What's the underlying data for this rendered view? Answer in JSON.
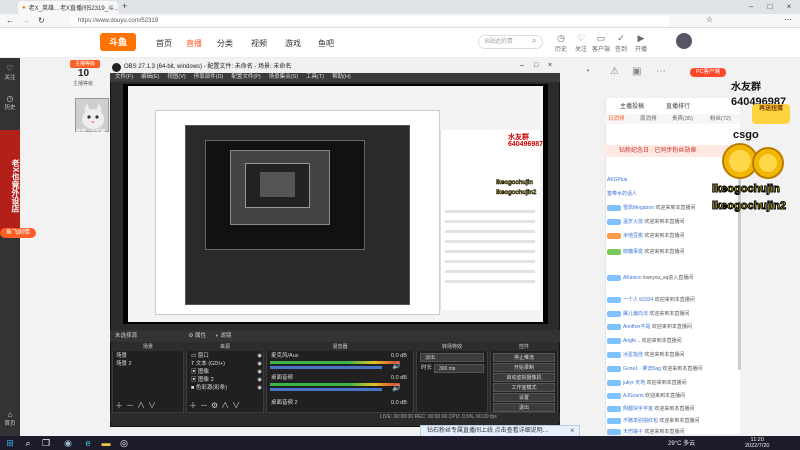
{
  "browser": {
    "tab_title": "老X_英雄…老X直播间52319_斗…",
    "url": "https://www.douyu.com/52319"
  },
  "header": {
    "logo": "斗鱼",
    "nav": [
      "首页",
      "直播",
      "分类",
      "视频",
      "游戏",
      "鱼吧"
    ],
    "search_placeholder": "B站达的贵",
    "icons": [
      "历史",
      "关注",
      "客户端",
      "签到",
      "开播"
    ]
  },
  "leftbar": {
    "items": [
      "关注",
      "历史",
      "导航"
    ],
    "banner_text": "老X也竟外设店",
    "fish_button": "鱼飞剧情",
    "bottom_item": "首页"
  },
  "streamer": {
    "level_badge": "主播等级",
    "level": "10",
    "level_label": "主播等级",
    "avatar_caption": "养猫 · 小宝美"
  },
  "douyu_right": {
    "pc_button": "PC客户端",
    "icons": [
      "分享",
      "举报",
      "客户端",
      "更多"
    ]
  },
  "chat": {
    "tabs": [
      "日消排",
      "周消排",
      "贵宾(35)",
      "粉丝(72)"
    ],
    "top_tabs": [
      "主播投稿",
      "直播排行"
    ],
    "fan_bar": "钻粉纪念日 · 已同步粉丝勋章",
    "lines": [
      {
        "name": "AKGPlus",
        "text": ""
      },
      {
        "name": "蜜带水的话人",
        "text": ""
      },
      {
        "name": "雪凯Megatron",
        "text": "欢迎来到本直播间"
      },
      {
        "name": "温岁火烧",
        "text": "欢迎来到本直播间"
      },
      {
        "name": "米他豆桃",
        "text": "欢迎来到本直播间"
      },
      {
        "name": "晓糖事变",
        "text": "欢迎来到本直播间"
      },
      {
        "name": "AKanivo",
        "text": "loveyou_sq进入直播间"
      },
      {
        "name": "一个人 b3334",
        "text": "欢迎来到本直播间"
      },
      {
        "name": "屠儿偏向法",
        "text": "欢迎来到本直播间"
      },
      {
        "name": "Another不是",
        "text": "欢迎来到本直播间"
      },
      {
        "name": "Angfe...",
        "text": "欢迎来到本直播间"
      },
      {
        "name": "冰星指佳",
        "text": "欢迎来到本直播间"
      },
      {
        "name": "Gone1 · 雾流5ag",
        "text": "欢迎来到本直播间"
      },
      {
        "name": "jukyr·天地",
        "text": "欢迎来到本直播间"
      },
      {
        "name": "AJGoumi",
        "text": "欢迎来到本直播间"
      },
      {
        "name": "刚都快手宇宙",
        "text": "欢迎来到本直播间"
      },
      {
        "name": "不赌单别捐红包",
        "text": "欢迎来到本直播间"
      },
      {
        "name": "天伤娘子",
        "text": "欢迎来到本直播间"
      }
    ]
  },
  "overlay": {
    "water_group": "水友群",
    "qq_number": "640496987",
    "csgo": "csgo",
    "name_yellow_1": "lkeogochujin",
    "name_yellow_2": "lkeogochujin2",
    "promo": "再送扭蛋"
  },
  "obs": {
    "title": "OBS 27.1.3 (64-bit, windows) - 配置文件: 未命名 - 场景: 未命名",
    "menu": [
      "文件(F)",
      "编辑(E)",
      "视图(V)",
      "停靠部件(D)",
      "配置文件(P)",
      "场景集合(S)",
      "工具(T)",
      "帮助(H)"
    ],
    "dock_bar": "未选择源",
    "dock_bar_btns": [
      "属性",
      "滤镜"
    ],
    "scenes_head": "场景",
    "scenes": [
      "场景",
      "场景 2"
    ],
    "sources_head": "来源",
    "sources": [
      "窗口",
      "文本 (GDI+)",
      "图像",
      "图像 2",
      "色彩源(彩条)"
    ],
    "mixer_head": "混音器",
    "mixer": [
      {
        "name": "麦克风/Aux",
        "db": "0.0 dB"
      },
      {
        "name": "桌面音频",
        "db": "0.0 dB"
      },
      {
        "name": "桌面音频 2",
        "db": "0.0 dB"
      }
    ],
    "transition_head": "转场特效",
    "transition_type": "淡出",
    "duration_label": "时长",
    "duration": "300 ms",
    "controls_head": "控件",
    "controls": [
      "停止推流",
      "开始录制",
      "启动虚拟摄像机",
      "工作室模式",
      "设置",
      "退出"
    ],
    "status": "LIVE: 00:00:00   REC: 00:00:00   CPU: 0.5%, 60.00 fps"
  },
  "bottom_banner": "钻石粉丝专属直播间上线 点击查看详细说明…",
  "taskbar": {
    "weather": "29°C 多云",
    "time": "11:20",
    "date": "2022/7/20"
  }
}
